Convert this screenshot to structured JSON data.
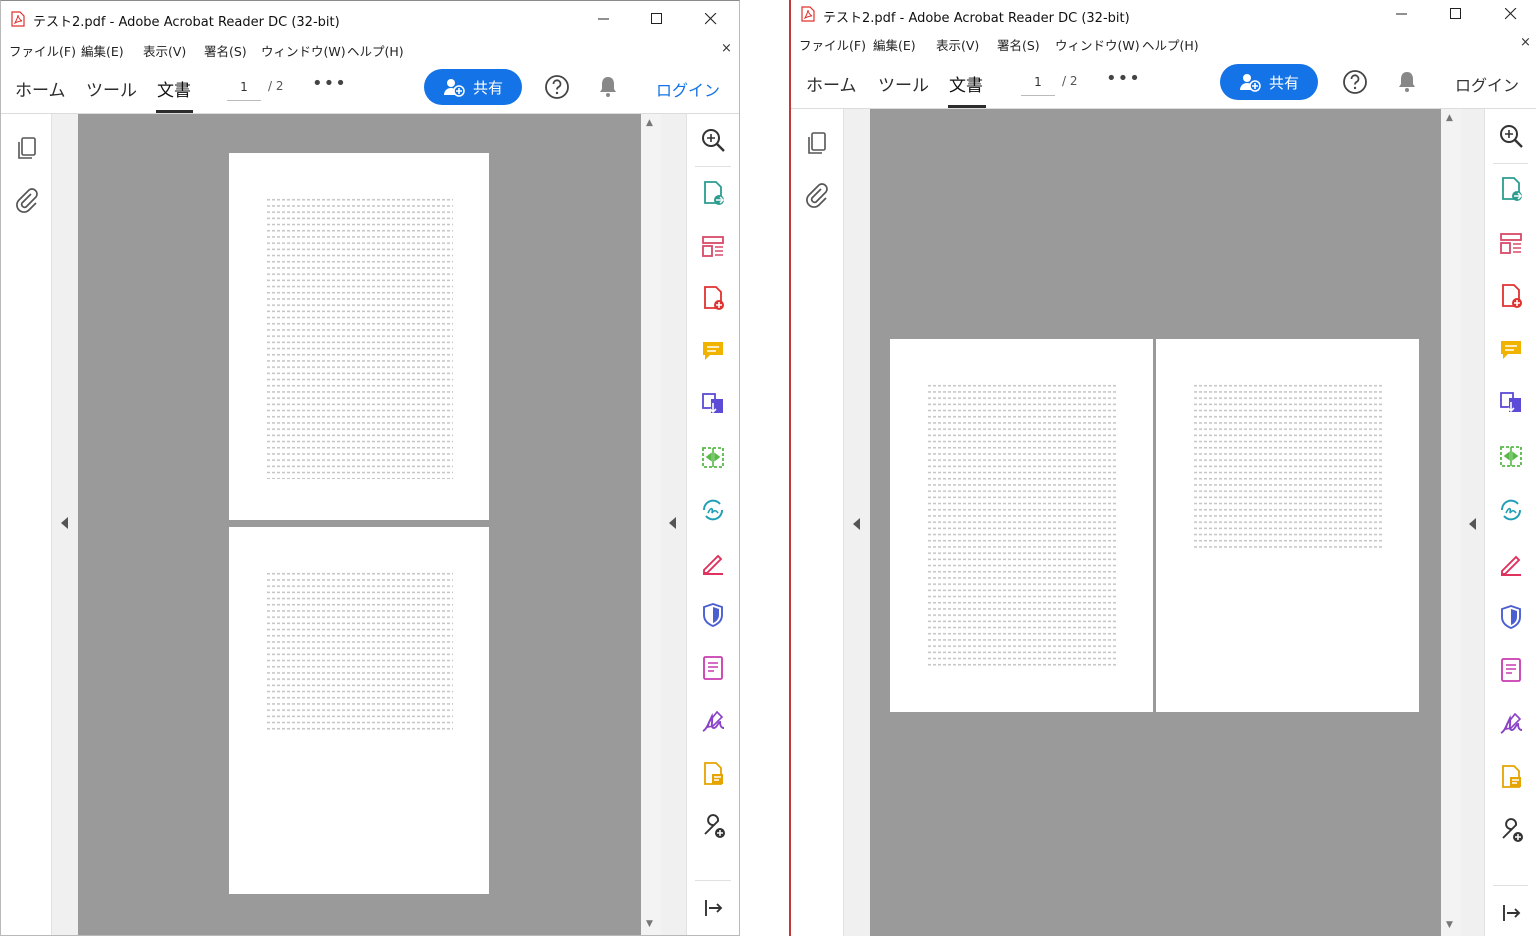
{
  "window_left": {
    "title": "テスト2.pdf - Adobe Acrobat Reader DC (32-bit)",
    "menu": [
      "ファイル(F)",
      "編集(E)",
      "表示(V)",
      "署名(S)",
      "ウィンドウ(W)",
      "ヘルプ(H)"
    ],
    "tabs": [
      "ホーム",
      "ツール",
      "文書"
    ],
    "active_tab": "文書",
    "page_current": "1",
    "page_total": "/ 2",
    "more_label": "•••",
    "share_label": "共有",
    "login_label": "ログイン",
    "close_doc": "×",
    "view_mode": "single-page continuous"
  },
  "window_right": {
    "title": "テスト2.pdf - Adobe Acrobat Reader DC (32-bit)",
    "menu": [
      "ファイル(F)",
      "編集(E)",
      "表示(V)",
      "署名(S)",
      "ウィンドウ(W)",
      "ヘルプ(H)"
    ],
    "tabs": [
      "ホーム",
      "ツール",
      "文書"
    ],
    "active_tab": "文書",
    "page_current": "1",
    "page_total": "/ 2",
    "more_label": "•••",
    "share_label": "共有",
    "login_label": "ログイン",
    "close_doc": "×",
    "view_mode": "two-page spread"
  },
  "colors": {
    "accent": "#1473e6",
    "viewer_bg": "#9a9a9a",
    "pdf_red": "#e0312f"
  },
  "right_rail_tools": [
    "zoom-icon",
    "export-pdf-icon",
    "organize-pages-icon",
    "create-pdf-icon",
    "comment-icon",
    "combine-files-icon",
    "compress-icon",
    "send-for-signature-icon",
    "fill-sign-icon",
    "protect-icon",
    "edit-text-icon",
    "sign-icon",
    "stamp-icon",
    "more-tools-icon",
    "expand-panel-icon"
  ],
  "left_rail_tools": [
    "page-thumbnails-icon",
    "attachments-icon"
  ]
}
